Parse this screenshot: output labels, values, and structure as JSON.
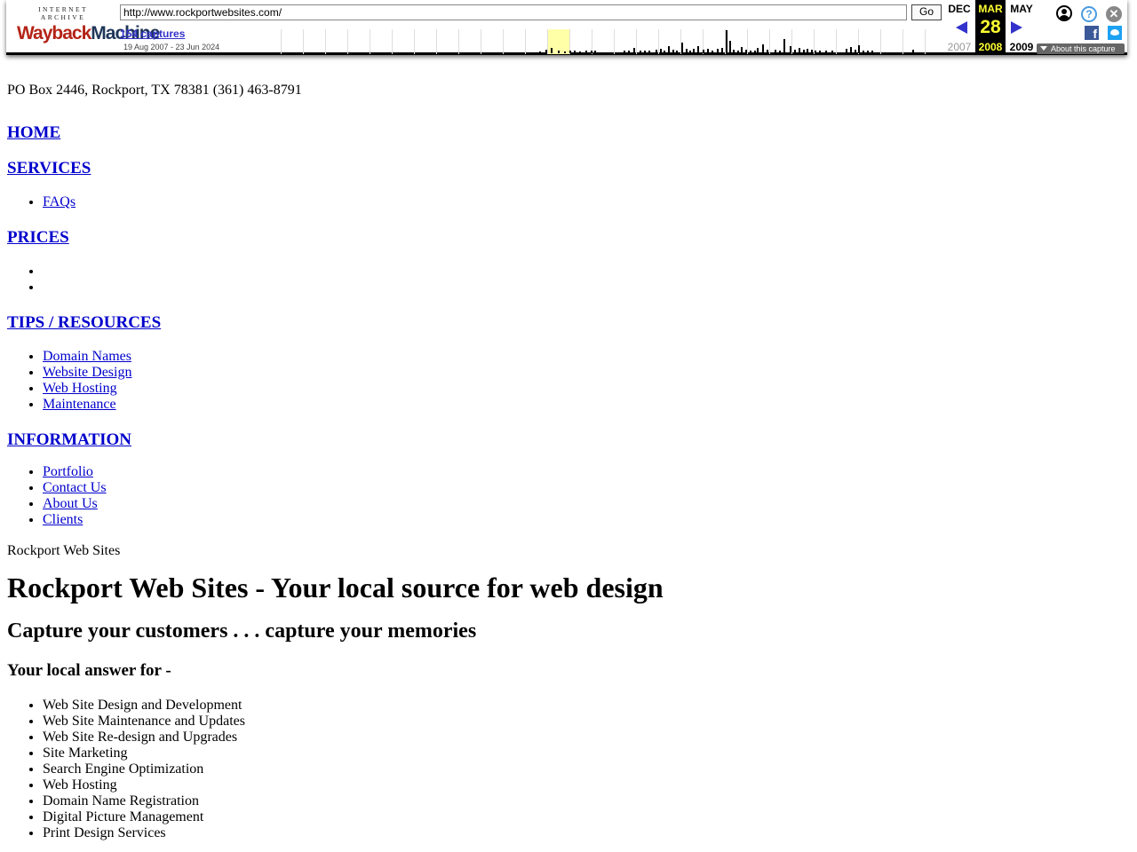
{
  "toolbar": {
    "logo_top": "INTERNET ARCHIVE",
    "logo_wayback": "Wayback",
    "logo_machine": "Machine",
    "url_value": "http://www.rockportwebsites.com/",
    "go_label": "Go",
    "captures_link": "154 captures",
    "date_range": "19 Aug 2007 - 23 Jun 2024",
    "calendar": {
      "prev_month": "DEC",
      "prev_year": "2007",
      "current_month": "MAR",
      "current_day": "28",
      "current_year": "2008",
      "next_month": "MAY",
      "next_year": "2009"
    },
    "help_glyph": "?",
    "close_glyph": "✕",
    "facebook_glyph": "f",
    "about_label": "About this capture",
    "colors": {
      "accent": "#3333cc",
      "highlight": "#ffff33",
      "logo_red": "#b42317",
      "logo_blue": "#1e3658"
    },
    "icons": [
      "user-icon",
      "help-icon",
      "close-icon",
      "facebook-icon",
      "twitter-icon",
      "prev-arrow-icon",
      "next-arrow-icon"
    ]
  },
  "page": {
    "address": "PO Box 2446, Rockport, TX 78381 (361) 463-8791",
    "nav": {
      "home": "HOME",
      "services": "SERVICES",
      "services_items": [
        "FAQs"
      ],
      "prices": "PRICES",
      "tips": "TIPS / RESOURCES",
      "tips_items": [
        "Domain Names",
        "Website Design",
        "Web Hosting",
        "Maintenance"
      ],
      "information": "INFORMATION",
      "information_items": [
        "Portfolio",
        "Contact Us",
        "About Us",
        "Clients"
      ]
    },
    "site_name": "Rockport Web Sites",
    "headline": "Rockport Web Sites - Your local source for web design",
    "subheadline": "Capture your customers . . . capture your memories",
    "answer_heading": "Your local answer for -",
    "services_list": [
      "Web Site Design and Development",
      "Web Site Maintenance and Updates",
      "Web Site Re-design and Upgrades",
      "Site Marketing",
      "Search Engine Optimization",
      "Web Hosting",
      "Domain Name Registration",
      "Digital Picture Management",
      "Print Design Services"
    ]
  }
}
